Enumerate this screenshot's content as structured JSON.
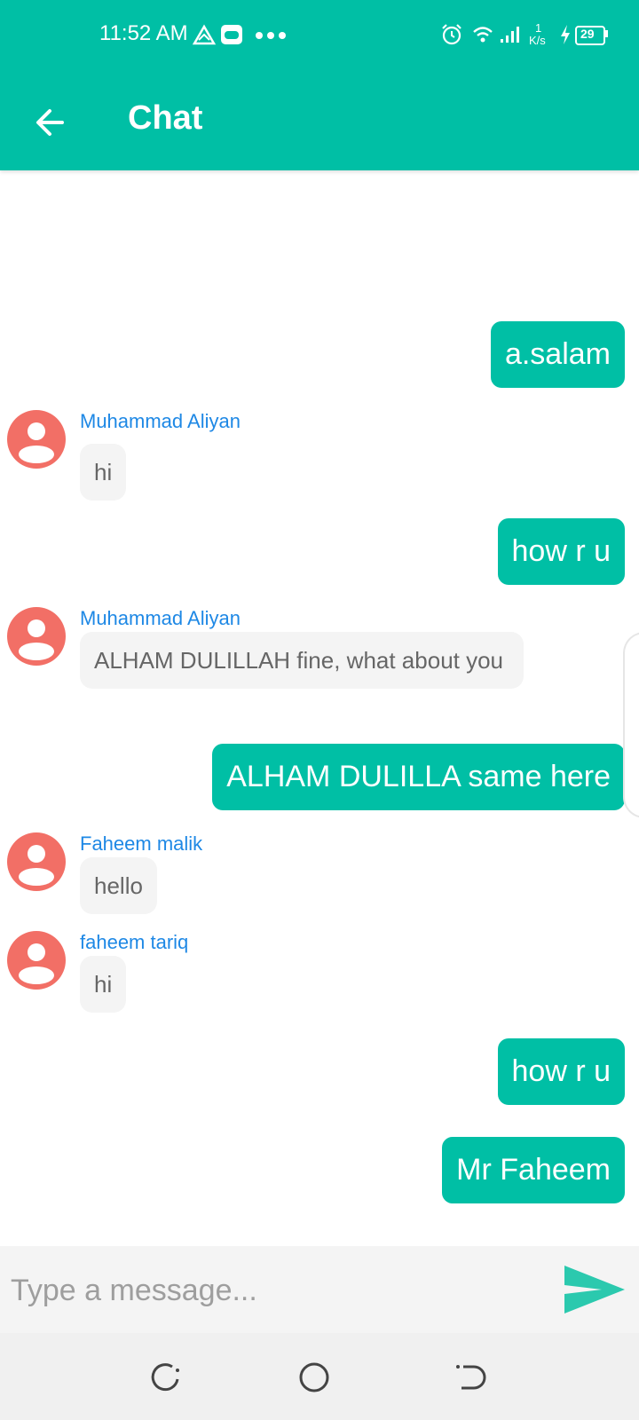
{
  "status_bar": {
    "time": "11:52 AM",
    "network_speed_value": "1",
    "network_speed_unit": "K/s",
    "battery": "29",
    "icons": [
      "triangle-notification-icon",
      "game-icon",
      "more-dots-icon",
      "alarm-icon",
      "wifi-icon",
      "signal-icon",
      "charging-icon",
      "battery-icon"
    ]
  },
  "app_bar": {
    "title": "Chat",
    "back_icon": "arrow-back-icon"
  },
  "theme": {
    "primary": "#00BFA5",
    "sender_name_color": "#1E88E5",
    "avatar_color": "#F26F66",
    "incoming_bubble": "#F4F4F4"
  },
  "messages": [
    {
      "direction": "out",
      "text": "a.salam"
    },
    {
      "direction": "in",
      "sender": "Muhammad Aliyan",
      "text": "hi"
    },
    {
      "direction": "out",
      "text": "how r u"
    },
    {
      "direction": "in",
      "sender": "Muhammad Aliyan",
      "text": "ALHAM DULILLAH fine, what about you"
    },
    {
      "direction": "out",
      "text": "ALHAM DULILLA same here"
    },
    {
      "direction": "in",
      "sender": "Faheem malik",
      "text": "hello"
    },
    {
      "direction": "in",
      "sender": "faheem tariq",
      "text": "hi"
    },
    {
      "direction": "out",
      "text": "how r u"
    },
    {
      "direction": "out",
      "text": "Mr Faheem"
    }
  ],
  "composer": {
    "placeholder": "Type a message...",
    "value": "",
    "send_icon": "send-icon"
  },
  "nav_bar": {
    "buttons": [
      "recent-apps-icon",
      "home-icon",
      "back-icon"
    ]
  }
}
